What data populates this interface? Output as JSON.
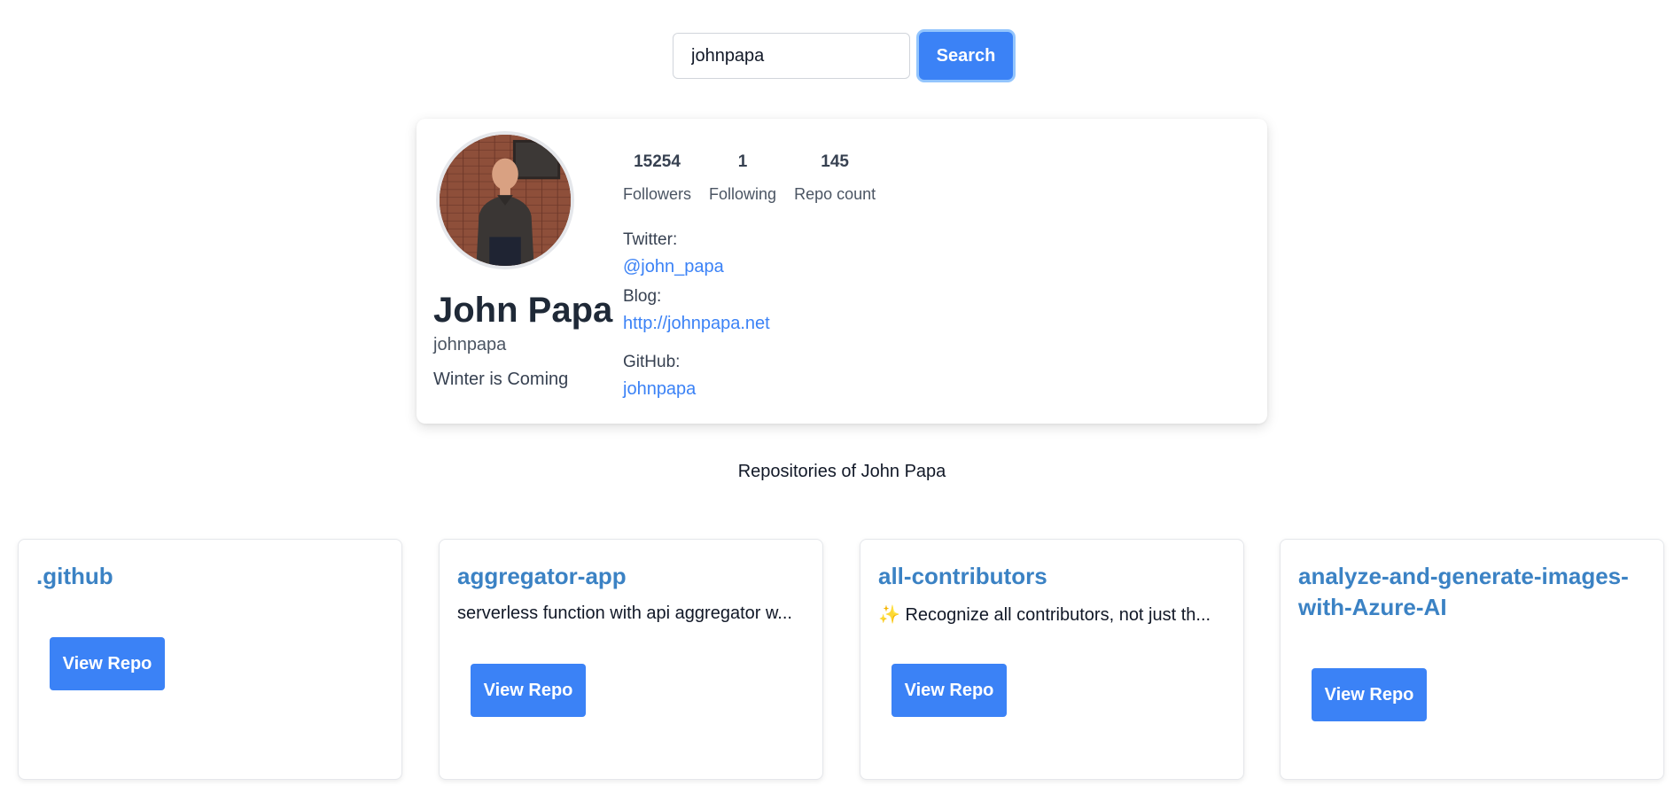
{
  "search": {
    "value": "johnpapa",
    "button_label": "Search"
  },
  "profile": {
    "name": "John Papa",
    "login": "johnpapa",
    "bio": "Winter is Coming",
    "stats": [
      {
        "value": "15254",
        "label": "Followers"
      },
      {
        "value": "1",
        "label": "Following"
      },
      {
        "value": "145",
        "label": "Repo count"
      }
    ],
    "twitter_label": "Twitter:",
    "twitter": "@john_papa",
    "blog_label": "Blog:",
    "blog": "http://johnpapa.net",
    "github_label": "GitHub:",
    "github": "johnpapa"
  },
  "repos_heading": "Repositories of John Papa",
  "repos": [
    {
      "name": ".github",
      "description": "",
      "button_label": "View Repo"
    },
    {
      "name": "aggregator-app",
      "description": "serverless function with api aggregator w...",
      "button_label": "View Repo"
    },
    {
      "name": "all-contributors",
      "description": "✨ Recognize all contributors, not just th...",
      "button_label": "View Repo"
    },
    {
      "name": "analyze-and-generate-images-with-Azure-AI",
      "description": "",
      "button_label": "View Repo"
    }
  ],
  "colors": {
    "accent": "#3b82f6",
    "repo_title": "#3b82c4",
    "link": "#3b82f6"
  }
}
